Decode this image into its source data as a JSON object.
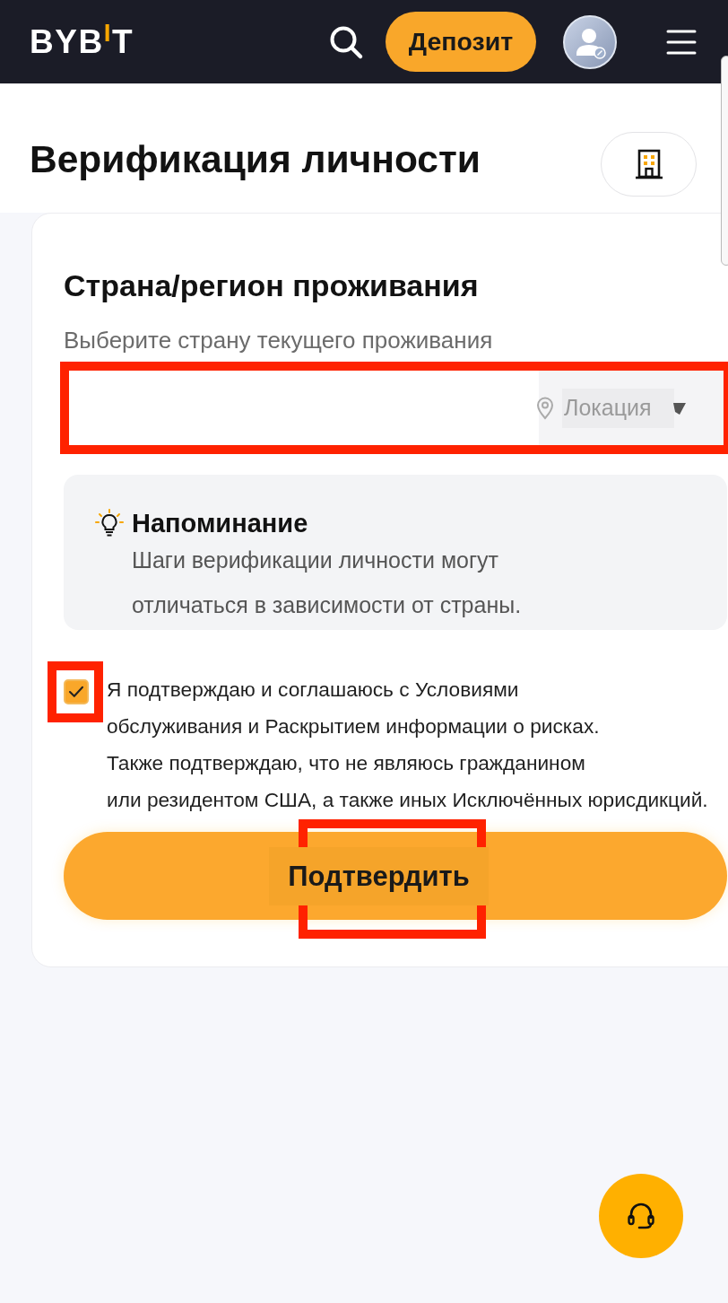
{
  "header": {
    "logo": [
      {
        "text": "BYB",
        "accent": false
      },
      {
        "text": "I",
        "accent": true
      },
      {
        "text": "T",
        "accent": false
      }
    ],
    "deposit_button": "Депозит"
  },
  "page": {
    "title": "Верификация личности"
  },
  "residence": {
    "heading": "Страна/регион проживания",
    "hint": "Выберите страну текущего проживания",
    "field": {
      "placeholder": "Локация",
      "highlighted": true
    }
  },
  "reminder": {
    "title": "Напоминание",
    "lines": [
      "Шаги верификации личности могут",
      "отличаться в зависимости от страны."
    ]
  },
  "consent": {
    "checked": true,
    "highlighted": true,
    "lines": [
      "Я подтверждаю и соглашаюсь с Условиями",
      "обслуживания и Раскрытием информации о рисках.",
      "Также подтверждаю, что не являюсь гражданином",
      "или резидентом США, а также иных Исключённых юрисдикций."
    ]
  },
  "confirm_button": {
    "label": "Подтвердить",
    "highlighted": true
  }
}
